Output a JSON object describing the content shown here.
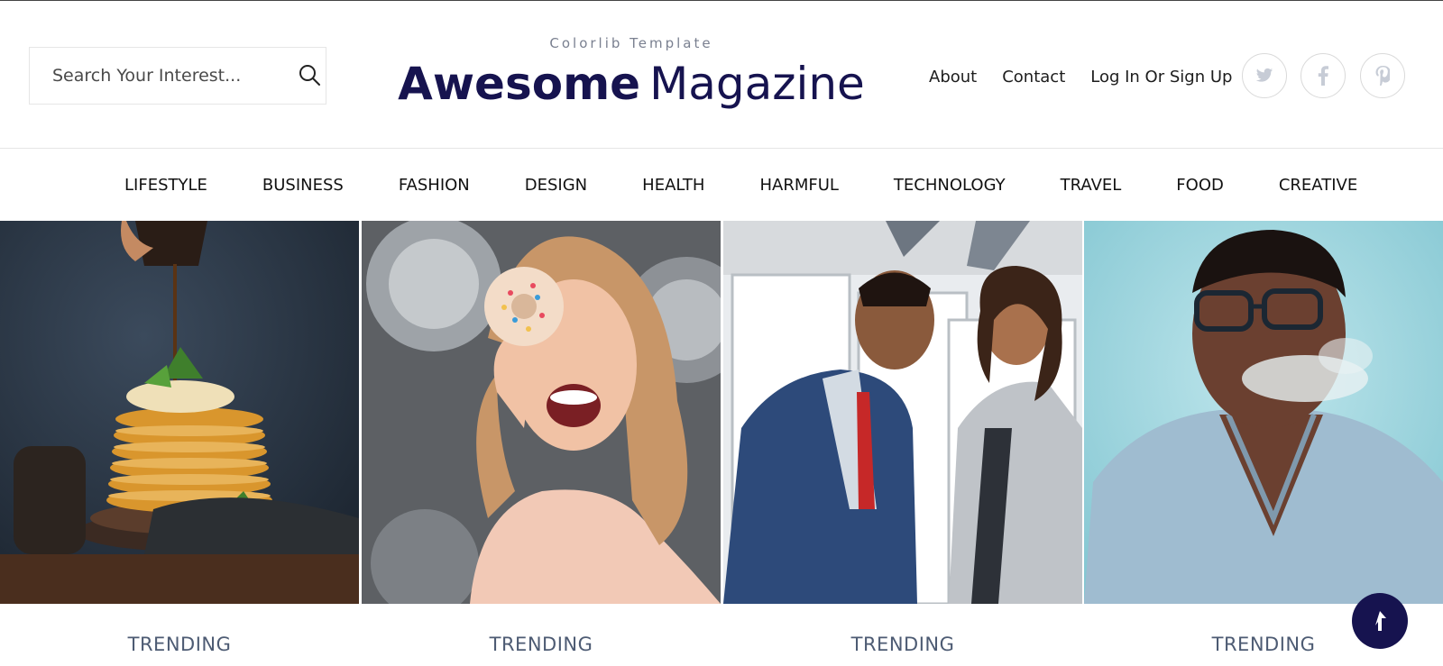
{
  "search": {
    "placeholder": "Search Your Interest..."
  },
  "brand": {
    "tagline": "Colorlib Template",
    "title_bold": "Awesome",
    "title_light": "Magazine"
  },
  "top_links": [
    "About",
    "Contact",
    "Log In Or Sign Up"
  ],
  "social": [
    "twitter-icon",
    "facebook-icon",
    "pinterest-icon"
  ],
  "nav": [
    "LIFESTYLE",
    "BUSINESS",
    "FASHION",
    "DESIGN",
    "HEALTH",
    "HARMFUL",
    "TECHNOLOGY",
    "TRAVEL",
    "FOOD",
    "CREATIVE"
  ],
  "cards": [
    {
      "category": "TRENDING",
      "image": "pancake-stack-photo"
    },
    {
      "category": "TRENDING",
      "image": "woman-with-donut-photo"
    },
    {
      "category": "TRENDING",
      "image": "business-couple-photo"
    },
    {
      "category": "TRENDING",
      "image": "man-with-glasses-smoke-photo"
    }
  ],
  "colors": {
    "brand": "#16134f",
    "category": "#4d5b73",
    "text": "#111111"
  }
}
